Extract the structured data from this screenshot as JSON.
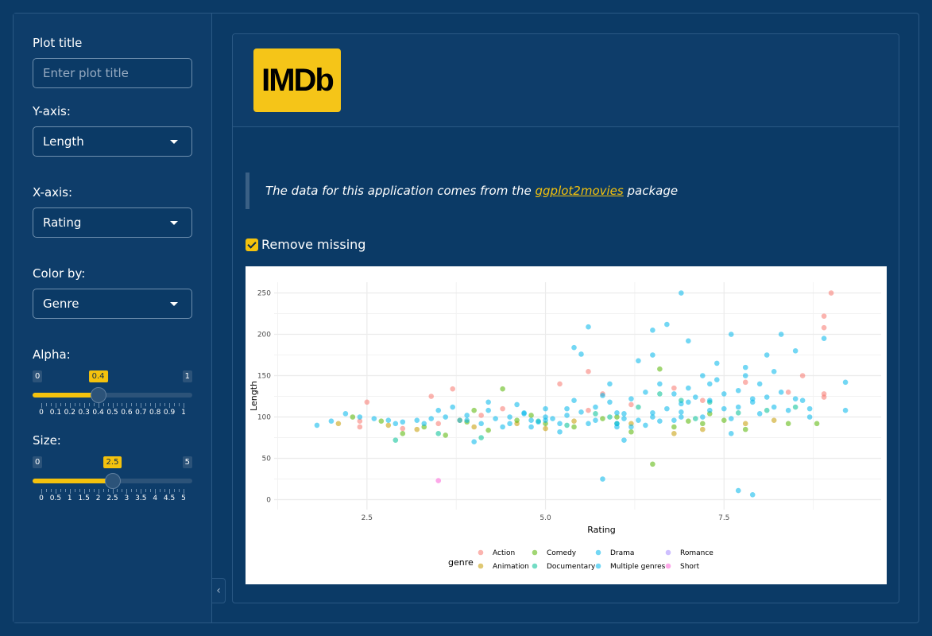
{
  "sidebar": {
    "plot_title": {
      "label": "Plot title",
      "placeholder": "Enter plot title"
    },
    "y_axis": {
      "label": "Y-axis:",
      "value": "Length"
    },
    "x_axis": {
      "label": "X-axis:",
      "value": "Rating"
    },
    "color_by": {
      "label": "Color by:",
      "value": "Genre"
    },
    "alpha": {
      "label": "Alpha:",
      "min": 0,
      "max": 1,
      "value": 0.4,
      "min_label": "0",
      "max_label": "1",
      "value_label": "0.4",
      "ticks": [
        "0",
        "0.1",
        "0.2",
        "0.3",
        "0.4",
        "0.5",
        "0.6",
        "0.7",
        "0.8",
        "0.9",
        "1"
      ]
    },
    "size": {
      "label": "Size:",
      "min": 0,
      "max": 5,
      "value": 2.5,
      "min_label": "0",
      "max_label": "5",
      "value_label": "2.5",
      "ticks": [
        "0",
        "0.5",
        "1",
        "1.5",
        "2",
        "2.5",
        "3",
        "3.5",
        "4",
        "4.5",
        "5"
      ]
    },
    "collapse_icon": "chevron-left-icon"
  },
  "header": {
    "logo_text": "IMDb",
    "logo_color": "#f5c518"
  },
  "content": {
    "quote_prefix": "The data for this application comes from the ",
    "quote_link": "ggplot2movies",
    "quote_suffix": " package",
    "remove_missing_label": "Remove missing",
    "remove_missing_checked": true
  },
  "colors": {
    "accent": "#f4c20d",
    "background": "#0b3a66"
  },
  "chart_data": {
    "type": "scatter",
    "title": "",
    "xlabel": "Rating",
    "ylabel": "Length",
    "xlim": [
      1.2,
      9.7
    ],
    "ylim": [
      -12,
      263
    ],
    "x_ticks": [
      2.5,
      5.0,
      7.5
    ],
    "x_tick_labels": [
      "2.5",
      "5.0",
      "7.5"
    ],
    "y_ticks": [
      0,
      50,
      100,
      150,
      200,
      250
    ],
    "y_tick_labels": [
      "0",
      "50",
      "100",
      "150",
      "200",
      "250"
    ],
    "grid": true,
    "legend_title": "genre",
    "legend_position": "bottom",
    "series": [
      {
        "name": "Action",
        "color": "#f8766d",
        "points": [
          [
            2.4,
            95
          ],
          [
            2.4,
            88
          ],
          [
            2.5,
            118
          ],
          [
            3.4,
            125
          ],
          [
            3.7,
            134
          ],
          [
            4.1,
            102
          ],
          [
            4.4,
            110
          ],
          [
            5.2,
            140
          ],
          [
            5.6,
            155
          ],
          [
            5.8,
            128
          ],
          [
            6.2,
            115
          ],
          [
            6.8,
            135
          ],
          [
            7.2,
            120
          ],
          [
            7.8,
            142
          ],
          [
            8.4,
            130
          ],
          [
            8.6,
            150
          ],
          [
            9.0,
            250
          ],
          [
            8.9,
            222
          ],
          [
            8.9,
            208
          ],
          [
            8.9,
            128
          ],
          [
            8.9,
            124
          ],
          [
            5.6,
            108
          ],
          [
            3.0,
            86
          ],
          [
            3.5,
            92
          ]
        ]
      },
      {
        "name": "Animation",
        "color": "#c49a00",
        "points": [
          [
            2.1,
            92
          ],
          [
            2.8,
            90
          ],
          [
            3.2,
            85
          ],
          [
            4.0,
            88
          ],
          [
            4.6,
            92
          ],
          [
            5.4,
            95
          ],
          [
            6.2,
            92
          ],
          [
            6.8,
            80
          ],
          [
            7.2,
            85
          ],
          [
            7.8,
            92
          ],
          [
            8.2,
            96
          ],
          [
            3.8,
            96
          ],
          [
            5.0,
            86
          ]
        ]
      },
      {
        "name": "Comedy",
        "color": "#53b400",
        "points": [
          [
            2.3,
            100
          ],
          [
            2.7,
            95
          ],
          [
            3.0,
            80
          ],
          [
            3.3,
            88
          ],
          [
            3.6,
            78
          ],
          [
            4.0,
            108
          ],
          [
            4.2,
            84
          ],
          [
            4.4,
            134
          ],
          [
            4.6,
            96
          ],
          [
            5.0,
            92
          ],
          [
            5.4,
            88
          ],
          [
            5.8,
            98
          ],
          [
            6.2,
            82
          ],
          [
            6.6,
            158
          ],
          [
            6.8,
            88
          ],
          [
            7.0,
            95
          ],
          [
            7.2,
            92
          ],
          [
            7.5,
            96
          ],
          [
            7.8,
            85
          ],
          [
            8.4,
            92
          ],
          [
            8.8,
            92
          ],
          [
            6.5,
            43
          ],
          [
            6.0,
            100
          ],
          [
            7.3,
            104
          ],
          [
            3.9,
            94
          ],
          [
            4.8,
            102
          ]
        ]
      },
      {
        "name": "Documentary",
        "color": "#00c094",
        "points": [
          [
            2.9,
            72
          ],
          [
            3.5,
            80
          ],
          [
            4.1,
            75
          ],
          [
            4.9,
            95
          ],
          [
            5.3,
            90
          ],
          [
            5.9,
            100
          ],
          [
            6.3,
            112
          ],
          [
            6.9,
            120
          ],
          [
            7.3,
            118
          ],
          [
            7.7,
            105
          ],
          [
            8.1,
            108
          ],
          [
            8.5,
            112
          ],
          [
            6.0,
            92
          ],
          [
            5.7,
            104
          ],
          [
            6.6,
            128
          ],
          [
            7.1,
            98
          ]
        ]
      },
      {
        "name": "Drama",
        "color": "#00b6eb",
        "points": [
          [
            1.8,
            90
          ],
          [
            2.0,
            95
          ],
          [
            2.2,
            104
          ],
          [
            2.6,
            98
          ],
          [
            2.9,
            92
          ],
          [
            3.2,
            96
          ],
          [
            3.5,
            108
          ],
          [
            3.8,
            96
          ],
          [
            4.0,
            70
          ],
          [
            4.2,
            118
          ],
          [
            4.5,
            92
          ],
          [
            4.8,
            96
          ],
          [
            5.0,
            100
          ],
          [
            5.2,
            82
          ],
          [
            5.4,
            184
          ],
          [
            5.5,
            176
          ],
          [
            5.6,
            209
          ],
          [
            5.8,
            25
          ],
          [
            6.0,
            92
          ],
          [
            6.1,
            72
          ],
          [
            6.3,
            168
          ],
          [
            6.5,
            205
          ],
          [
            6.7,
            212
          ],
          [
            6.9,
            250
          ],
          [
            7.0,
            192
          ],
          [
            7.2,
            150
          ],
          [
            7.4,
            165
          ],
          [
            7.6,
            200
          ],
          [
            7.8,
            160
          ],
          [
            8.0,
            140
          ],
          [
            8.2,
            112
          ],
          [
            8.3,
            200
          ],
          [
            8.5,
            180
          ],
          [
            8.7,
            100
          ],
          [
            8.9,
            195
          ],
          [
            9.2,
            142
          ],
          [
            7.9,
            6
          ],
          [
            7.7,
            11
          ],
          [
            6.0,
            105
          ],
          [
            6.4,
            130
          ],
          [
            6.8,
            128
          ],
          [
            7.5,
            110
          ],
          [
            5.0,
            96
          ],
          [
            4.4,
            88
          ],
          [
            3.9,
            102
          ],
          [
            6.6,
            95
          ],
          [
            7.0,
            118
          ],
          [
            8.1,
            175
          ],
          [
            8.6,
            120
          ],
          [
            5.9,
            140
          ],
          [
            6.2,
            88
          ],
          [
            7.3,
            140
          ],
          [
            7.9,
            122
          ],
          [
            5.3,
            110
          ],
          [
            4.7,
            105
          ],
          [
            6.5,
            175
          ],
          [
            7.6,
            80
          ],
          [
            6.9,
            100
          ]
        ]
      },
      {
        "name": "Multiple genres",
        "color": "#00b6eb",
        "points": [
          [
            2.4,
            100
          ],
          [
            3.0,
            94
          ],
          [
            3.3,
            92
          ],
          [
            3.6,
            100
          ],
          [
            3.9,
            96
          ],
          [
            4.1,
            92
          ],
          [
            4.3,
            98
          ],
          [
            4.5,
            100
          ],
          [
            4.7,
            104
          ],
          [
            4.9,
            94
          ],
          [
            5.1,
            98
          ],
          [
            5.3,
            102
          ],
          [
            5.5,
            106
          ],
          [
            5.7,
            112
          ],
          [
            5.9,
            118
          ],
          [
            6.1,
            104
          ],
          [
            6.3,
            96
          ],
          [
            6.5,
            100
          ],
          [
            6.7,
            110
          ],
          [
            6.9,
            116
          ],
          [
            7.1,
            124
          ],
          [
            7.3,
            120
          ],
          [
            7.5,
            128
          ],
          [
            7.7,
            132
          ],
          [
            7.9,
            118
          ],
          [
            8.1,
            124
          ],
          [
            8.3,
            130
          ],
          [
            8.5,
            122
          ],
          [
            8.7,
            110
          ],
          [
            4.6,
            115
          ],
          [
            5.0,
            110
          ],
          [
            5.4,
            120
          ],
          [
            5.8,
            126
          ],
          [
            6.2,
            122
          ],
          [
            6.6,
            140
          ],
          [
            7.0,
            135
          ],
          [
            7.4,
            145
          ],
          [
            7.8,
            150
          ],
          [
            8.2,
            155
          ],
          [
            4.2,
            108
          ],
          [
            3.7,
            112
          ],
          [
            5.6,
            92
          ],
          [
            6.0,
            88
          ],
          [
            6.4,
            90
          ],
          [
            6.8,
            96
          ],
          [
            7.2,
            100
          ],
          [
            7.6,
            98
          ],
          [
            8.0,
            104
          ],
          [
            8.4,
            108
          ],
          [
            4.8,
            88
          ],
          [
            5.2,
            92
          ],
          [
            5.7,
            96
          ],
          [
            6.1,
            98
          ],
          [
            6.5,
            105
          ],
          [
            6.9,
            106
          ],
          [
            7.3,
            108
          ],
          [
            7.7,
            112
          ],
          [
            3.4,
            98
          ],
          [
            2.8,
            96
          ],
          [
            9.2,
            108
          ]
        ]
      },
      {
        "name": "Romance",
        "color": "#a58aff",
        "points": []
      },
      {
        "name": "Short",
        "color": "#fb61d7",
        "points": [
          [
            3.5,
            23
          ]
        ]
      }
    ]
  }
}
